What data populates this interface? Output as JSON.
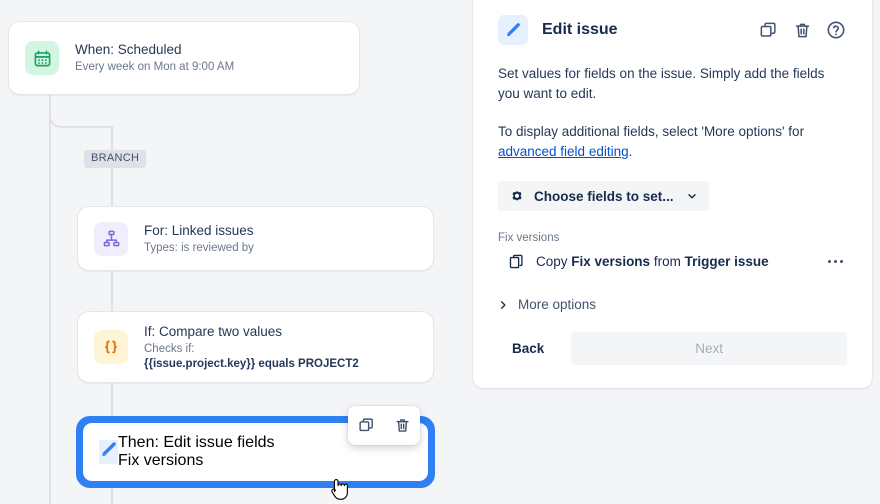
{
  "canvas": {
    "branch_label": "BRANCH",
    "nodes": [
      {
        "id": "trigger",
        "icon": "calendar-icon",
        "title": "When: Scheduled",
        "subtitle": "Every week on Mon at 9:00 AM"
      },
      {
        "id": "for",
        "icon": "hierarchy-icon",
        "title": "For: Linked issues",
        "subtitle": "Types: is reviewed by"
      },
      {
        "id": "if",
        "icon": "braces-icon",
        "title": "If: Compare two values",
        "subtitle": "Checks if:",
        "detail": "{{issue.project.key}} equals PROJECT2"
      },
      {
        "id": "then",
        "icon": "pencil-icon",
        "title": "Then: Edit issue fields",
        "subtitle": "Fix versions",
        "selected": true
      }
    ],
    "node_toolbar": {
      "copy_label": "Copy rule component",
      "delete_label": "Delete rule component"
    }
  },
  "panel": {
    "title": "Edit issue",
    "header_icon": "pencil-icon",
    "actions": [
      {
        "name": "copy-icon",
        "label": "Copy"
      },
      {
        "name": "trash-icon",
        "label": "Delete"
      },
      {
        "name": "help-icon",
        "label": "Help"
      }
    ],
    "description": "Set values for fields on the issue. Simply add the fields you want to edit.",
    "hint_prefix": "To display additional fields, select 'More options' for ",
    "hint_link": "advanced field editing",
    "hint_suffix": ".",
    "choose_fields": {
      "icon": "gear-icon",
      "label": "Choose fields to set...",
      "chevron": "chevron-down-icon"
    },
    "field": {
      "label": "Fix versions",
      "icon": "copy-fields-icon",
      "row_prefix": "Copy ",
      "row_bold1": "Fix versions",
      "row_middle": " from ",
      "row_bold2": "Trigger issue",
      "overflow": "more-actions-icon"
    },
    "more_options": {
      "icon": "chevron-right-icon",
      "label": "More options"
    },
    "footer": {
      "back_label": "Back",
      "next_label": "Next",
      "next_disabled": true
    }
  },
  "colors": {
    "page_bg": "#f4f5f7",
    "panel_bg": "#ffffff",
    "selection_blue": "#2f80f5",
    "link_blue": "#0052cc",
    "text_dark": "#172b4d",
    "text_muted": "#6b778c",
    "connector": "#dfe1e6",
    "calendar_bg": "#d3f6e3",
    "calendar_fg": "#22a06b",
    "hierarchy_bg": "#f0eefc",
    "hierarchy_fg": "#7b68d9",
    "braces_bg": "#fff4d6",
    "braces_fg": "#e8720c",
    "pencil_bg": "#e6f0ff",
    "pencil_fg": "#2f80f5"
  }
}
